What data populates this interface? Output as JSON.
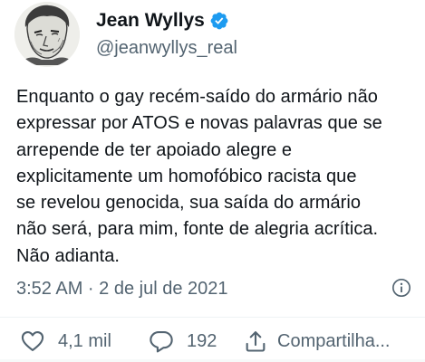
{
  "author": {
    "display_name": "Jean Wyllys",
    "handle": "@jeanwyllys_real",
    "verified": true,
    "avatar_icon": "sketch-portrait-avatar"
  },
  "tweet": {
    "lines": [
      "Enquanto o gay recém-saído do armário não",
      "expressar por ATOS e novas palavras que se",
      "arrepende de ter apoiado alegre e",
      "explicitamente um homofóbico racista que",
      "se revelou genocida, sua saída do armário",
      "não será, para mim, fonte de alegria acrítica.",
      "Não adianta."
    ],
    "timestamp": "3:52 AM · 2 de jul de 2021"
  },
  "actions": {
    "like": {
      "icon": "heart-icon",
      "count": "4,1 mil"
    },
    "reply": {
      "icon": "comment-icon",
      "count": "192"
    },
    "share": {
      "icon": "share-icon",
      "label": "Compartilha..."
    }
  },
  "colors": {
    "text": "#0f1419",
    "secondary": "#536471",
    "verified": "#1d9bf0",
    "divider": "#eff3f4"
  }
}
